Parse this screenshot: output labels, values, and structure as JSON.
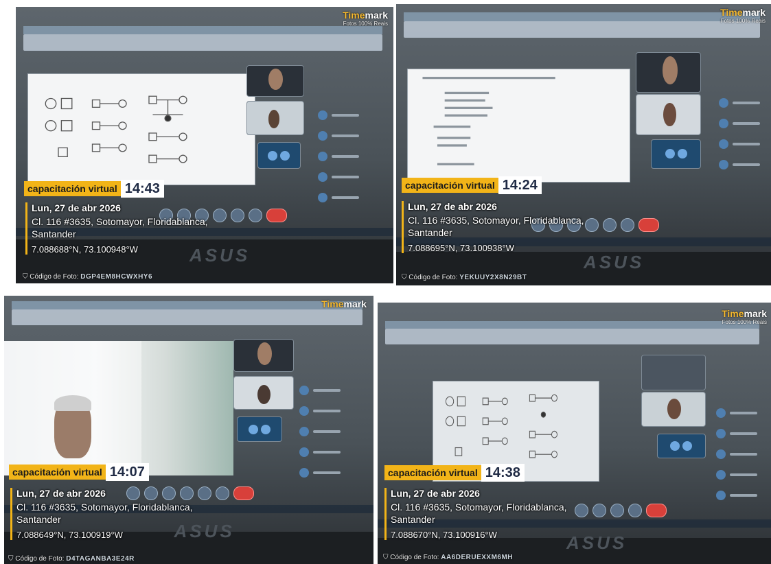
{
  "panels": [
    {
      "timemark": {
        "brand_part1": "Time",
        "brand_part2": "mark",
        "subtitle": "Fotos 100% Reais"
      },
      "badge": {
        "label": "capacitación virtual",
        "time": "14:43"
      },
      "info": {
        "date": "Lun, 27 de abr 2026",
        "address_line1": "Cl. 116 #3635, Sotomayor, Floridablanca,",
        "address_line2": "Santander",
        "coords": "7.088688°N, 73.100948°W"
      },
      "photo_code": {
        "label": "Código de Foto:",
        "value": "DGP4EM8HCWXHY6"
      },
      "laptop_brand": "ASUS"
    },
    {
      "timemark": {
        "brand_part1": "Time",
        "brand_part2": "mark",
        "subtitle": "Fotos 100% Reais"
      },
      "badge": {
        "label": "capacitación virtual",
        "time": "14:24"
      },
      "info": {
        "date": "Lun, 27 de abr 2026",
        "address_line1": "Cl. 116 #3635, Sotomayor, Floridablanca,",
        "address_line2": "Santander",
        "coords": "7.088695°N, 73.100938°W"
      },
      "photo_code": {
        "label": "Código de Foto:",
        "value": "YEKUUY2X8N29BT"
      },
      "laptop_brand": "ASUS"
    },
    {
      "timemark": {
        "brand_part1": "Time",
        "brand_part2": "mark",
        "subtitle": ""
      },
      "badge": {
        "label": "capacitación virtual",
        "time": "14:07"
      },
      "info": {
        "date": "Lun, 27 de abr 2026",
        "address_line1": "Cl. 116 #3635, Sotomayor, Floridablanca,",
        "address_line2": "Santander",
        "coords": "7.088649°N, 73.100919°W"
      },
      "photo_code": {
        "label": "Código de Foto:",
        "value": "D4TAGANBA3E24R"
      },
      "laptop_brand": "ASUS"
    },
    {
      "timemark": {
        "brand_part1": "Time",
        "brand_part2": "mark",
        "subtitle": "Fotos 100% Reais"
      },
      "badge": {
        "label": "capacitación virtual",
        "time": "14:38"
      },
      "info": {
        "date": "Lun, 27 de abr 2026",
        "address_line1": "Cl. 116 #3635, Sotomayor, Floridablanca,",
        "address_line2": "Santander",
        "coords": "7.088670°N, 73.100916°W"
      },
      "photo_code": {
        "label": "Código de Foto:",
        "value": "AA6DERUEXXM6MH"
      },
      "laptop_brand": "ASUS"
    }
  ]
}
